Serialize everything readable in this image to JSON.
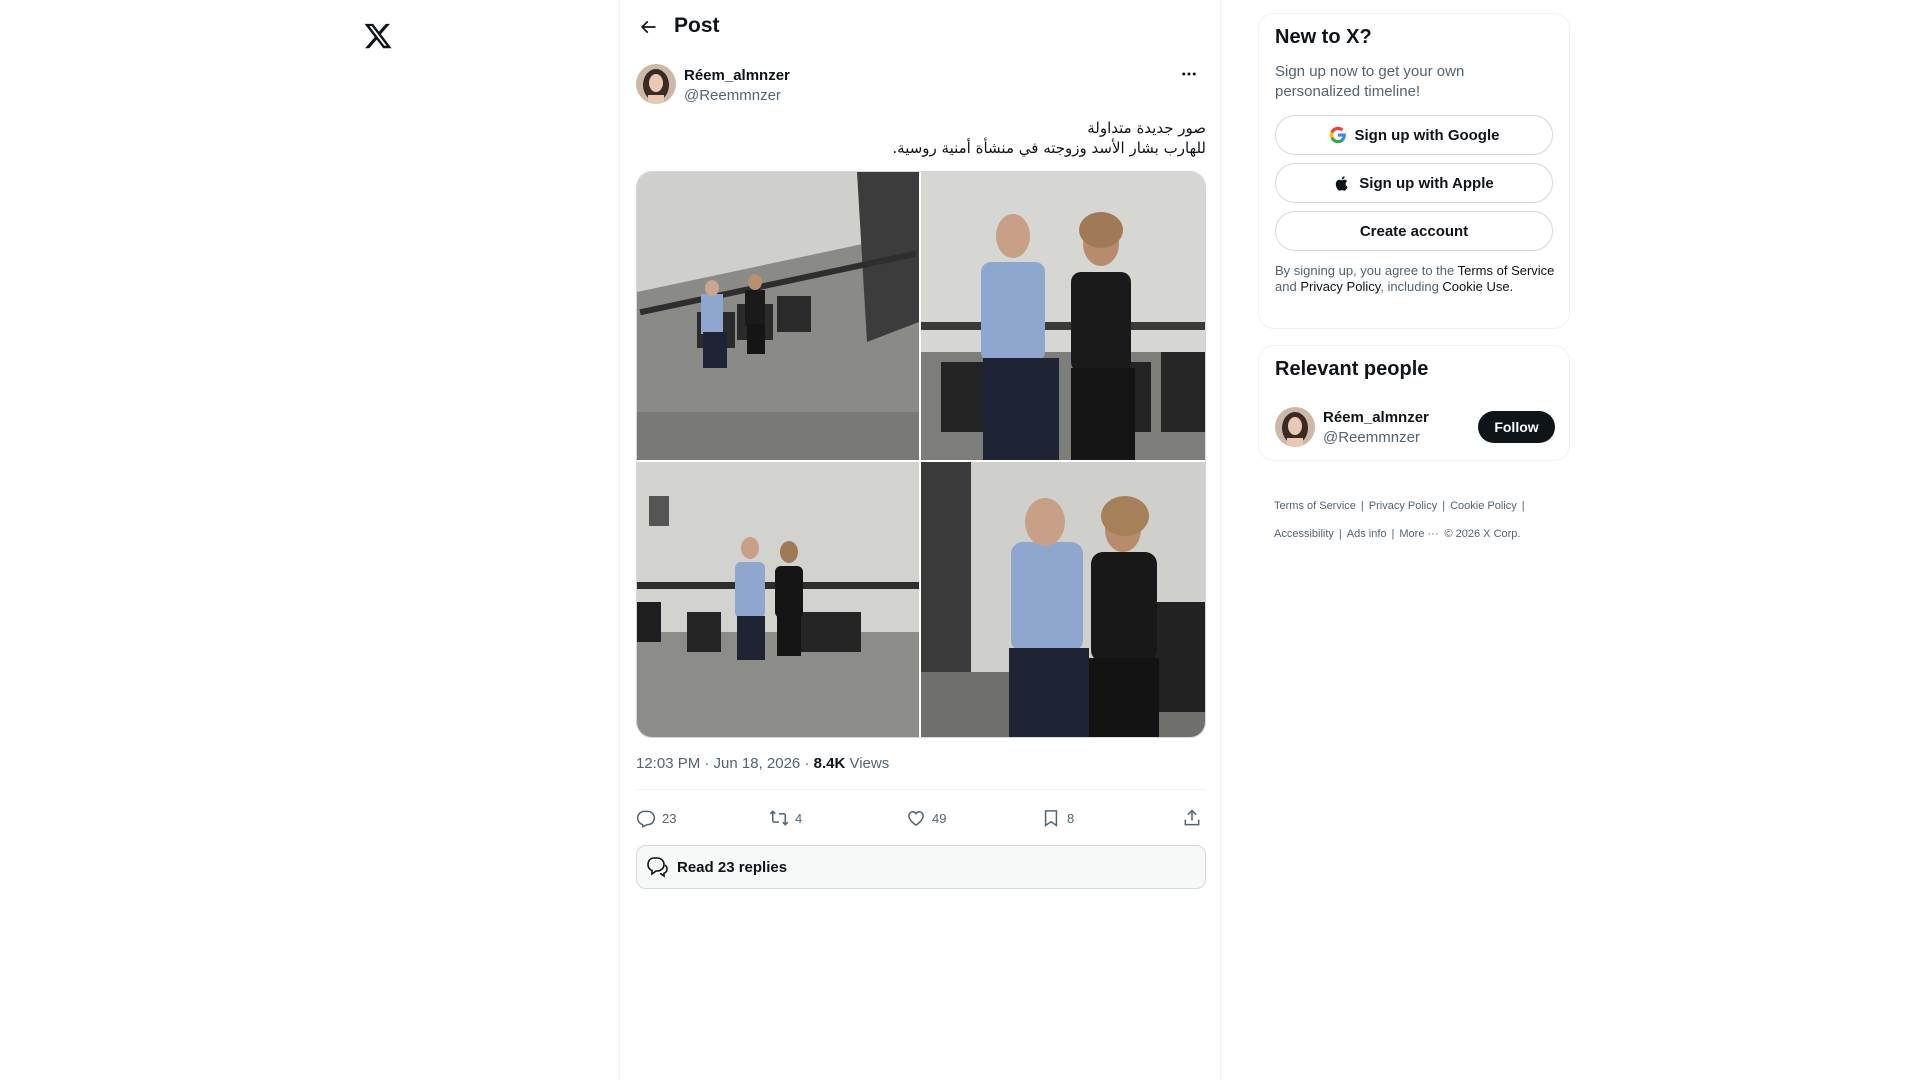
{
  "header": {
    "title": "Post"
  },
  "tweet": {
    "author_name": "Réem_almnzer",
    "author_handle": "@Reemmnzer",
    "text_lines": [
      "صور جديدة متداولة",
      "للهارب بشار الأسد وزوجته في منشأة أمنية روسية."
    ],
    "time": "12:03 PM · Jun 18, 2026 · ",
    "views_count": "8.4K",
    "views_label": " Views",
    "replies": "23",
    "retweets": "4",
    "likes": "49",
    "bookmarks": "8",
    "read_replies": "Read 23 replies",
    "photo_count": 4
  },
  "signup": {
    "title": "New to X?",
    "subtitle": "Sign up now to get your own personalized timeline!",
    "google": "Sign up with Google",
    "apple": "Sign up with Apple",
    "create": "Create account",
    "legal_prefix": "By signing up, you agree to the ",
    "terms": "Terms of Service",
    "and": " and ",
    "privacy": "Privacy Policy",
    "including": ", including ",
    "cookie": "Cookie Use."
  },
  "relevant": {
    "title": "Relevant people",
    "name": "Réem_almnzer",
    "handle": "@Reemmnzer",
    "follow": "Follow"
  },
  "footer": {
    "terms": "Terms of Service",
    "privacy": "Privacy Policy",
    "cookie": "Cookie Policy",
    "accessibility": "Accessibility",
    "ads": "Ads info",
    "more": "More ···",
    "copyright": "© 2026 X Corp."
  },
  "colors": {
    "text": "#0f1419",
    "secondary": "#536471",
    "border": "#cfd9de",
    "divider": "#eff3f4"
  },
  "icons": [
    "x-logo-icon",
    "back-arrow-icon",
    "more-icon",
    "reply-icon",
    "retweet-icon",
    "like-icon",
    "bookmark-icon",
    "share-icon",
    "chat-bubbles-icon",
    "google-icon",
    "apple-icon"
  ]
}
